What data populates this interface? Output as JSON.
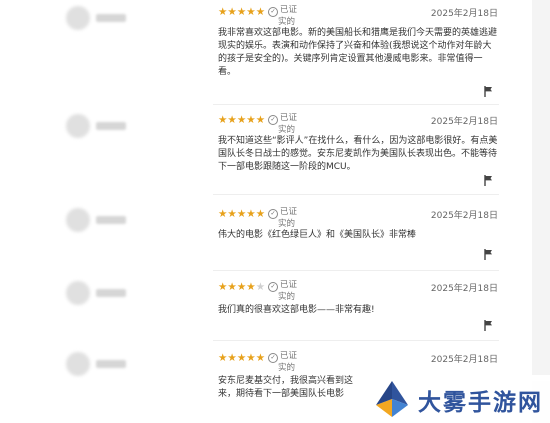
{
  "reviews": [
    {
      "stars": 5,
      "verified_line1": "已证",
      "verified_line2": "实的",
      "date": "2025年2月18日",
      "text": "我非常喜欢这部电影。新的美国船长和猎鹰是我们今天需要的英雄逃避现实的娱乐。表演和动作保持了兴奋和体验(我想说这个动作对年龄大的孩子是安全的)。关键序列肯定设置其他漫威电影来。非常值得一看。"
    },
    {
      "stars": 5,
      "verified_line1": "已证",
      "verified_line2": "实的",
      "date": "2025年2月18日",
      "text": "我不知道这些“影评人”在找什么，看什么，因为这部电影很好。有点美国队长冬日战士的感觉。安东尼麦凯作为美国队长表现出色。不能等待下一部电影跟随这一阶段的MCU。"
    },
    {
      "stars": 5,
      "verified_line1": "已证",
      "verified_line2": "实的",
      "date": "2025年2月18日",
      "text": "伟大的电影《红色绿巨人》和《美国队长》非常棒"
    },
    {
      "stars": 4,
      "verified_line1": "已证",
      "verified_line2": "实的",
      "date": "2025年2月18日",
      "text": "我们真的很喜欢这部电影——非常有趣!"
    },
    {
      "stars": 5,
      "verified_line1": "已证",
      "verified_line2": "实的",
      "date": "2025年2月18日",
      "text": "安东尼麦基交付，我很高兴看到这\n来，期待看下一部美国队长电影"
    }
  ],
  "icons": {
    "star": "star-icon",
    "verified": "verified-check-icon",
    "flag": "flag-icon"
  },
  "colors": {
    "star": "#e7a11b",
    "watermark": "#2a4f9a"
  },
  "watermark": {
    "text": "大雾手游网"
  }
}
